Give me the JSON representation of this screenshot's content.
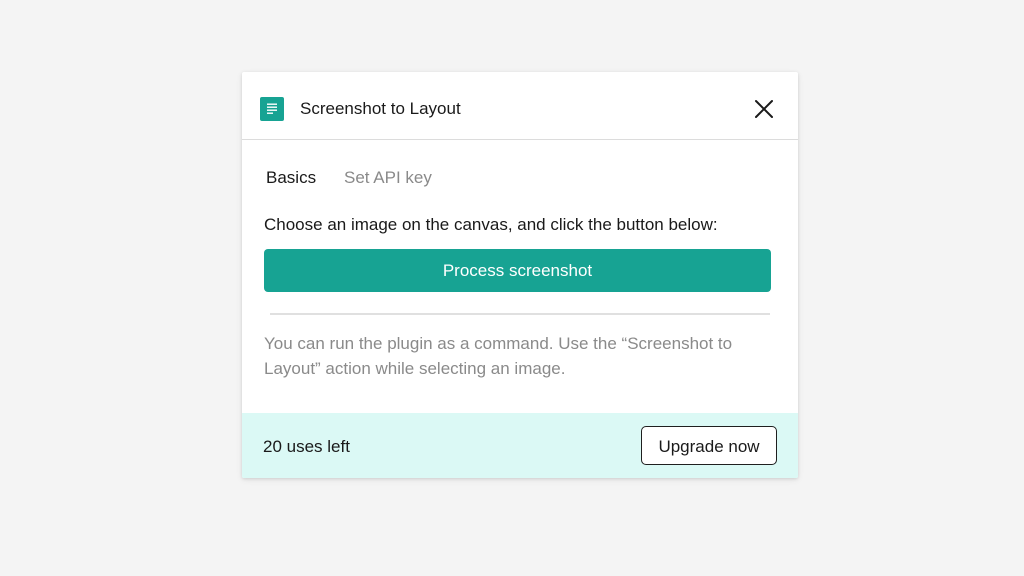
{
  "dialog": {
    "title": "Screenshot to Layout",
    "app_icon": "document-icon",
    "close_icon": "close-icon"
  },
  "tabs": [
    {
      "label": "Basics",
      "active": true
    },
    {
      "label": "Set API key",
      "active": false
    }
  ],
  "main": {
    "instruction": "Choose an image on the canvas, and click the button below:",
    "process_button_label": "Process screenshot",
    "help_text": "You can run the plugin as a command. Use the “Screenshot to Layout” action while selecting an image."
  },
  "footer": {
    "uses_left": "20 uses left",
    "upgrade_button_label": "Upgrade now"
  },
  "colors": {
    "accent": "#17a393",
    "footer_background": "#dbf9f5",
    "page_background": "#f4f4f4"
  }
}
